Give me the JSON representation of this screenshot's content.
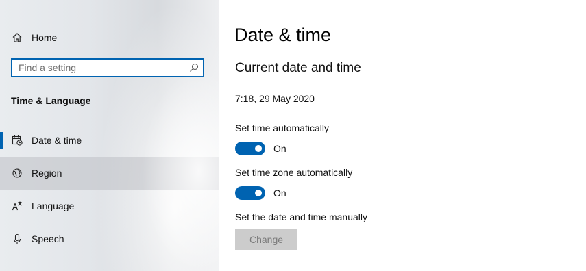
{
  "sidebar": {
    "home_label": "Home",
    "search": {
      "placeholder": "Find a setting",
      "value": ""
    },
    "section_title": "Time & Language",
    "items": [
      {
        "label": "Date & time",
        "icon": "calendar-clock-icon",
        "selected": true
      },
      {
        "label": "Region",
        "icon": "globe-icon",
        "hovered": true
      },
      {
        "label": "Language",
        "icon": "language-icon"
      },
      {
        "label": "Speech",
        "icon": "microphone-icon"
      }
    ]
  },
  "main": {
    "title": "Date & time",
    "subtitle": "Current date and time",
    "current_datetime": "7:18, 29 May 2020",
    "set_time_auto": {
      "label": "Set time automatically",
      "state": "On"
    },
    "set_timezone_auto": {
      "label": "Set time zone automatically",
      "state": "On"
    },
    "manual": {
      "label": "Set the date and time manually",
      "button_label": "Change"
    }
  },
  "colors": {
    "accent": "#0063b1",
    "disabled_button_bg": "#cccccc",
    "disabled_button_text": "#7a7a7a"
  }
}
